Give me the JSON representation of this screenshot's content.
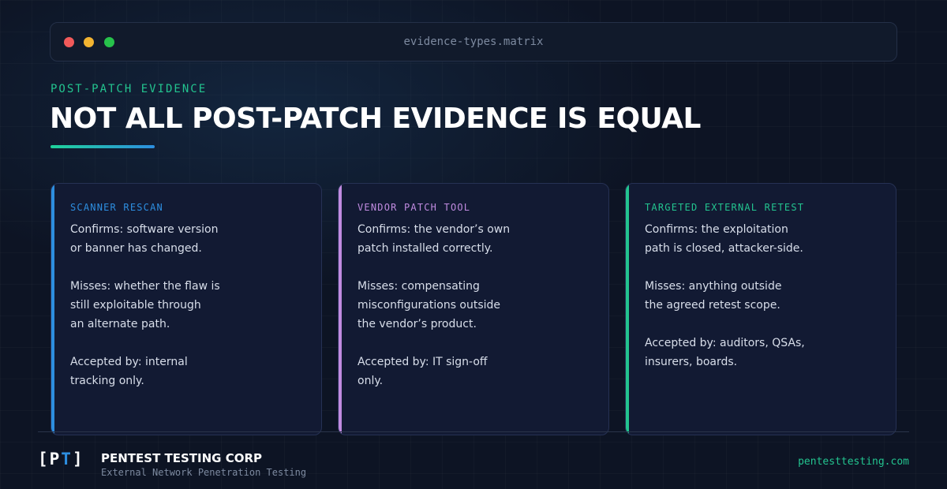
{
  "window": {
    "title": "evidence-types.matrix",
    "controls": [
      "close-dot",
      "minimize-dot",
      "maximize-dot"
    ]
  },
  "hero": {
    "eyebrow": "POST-PATCH EVIDENCE",
    "headline": "NOT ALL POST-PATCH EVIDENCE IS EQUAL"
  },
  "cards": [
    {
      "tag": "SCANNER RESCAN",
      "accent": "#2d8ee0",
      "lines": [
        "Confirms: software version",
        "or banner has changed.",
        "",
        "Misses: whether the flaw is",
        "still exploitable through",
        "an alternate path.",
        "",
        "Accepted by: internal",
        "tracking only."
      ]
    },
    {
      "tag": "VENDOR PATCH TOOL",
      "accent": "#c08be0",
      "lines": [
        "Confirms: the vendor’s own",
        "patch installed correctly.",
        "",
        "Misses: compensating",
        "misconfigurations outside",
        "the vendor’s product.",
        "",
        "Accepted by: IT sign-off",
        "only."
      ]
    },
    {
      "tag": "TARGETED EXTERNAL RETEST",
      "accent": "#23c48f",
      "lines": [
        "Confirms: the exploitation",
        "path is closed, attacker-side.",
        "",
        "Misses: anything outside",
        "the agreed retest scope.",
        "",
        "Accepted by: auditors, QSAs,",
        "insurers, boards."
      ]
    }
  ],
  "footer": {
    "logo_open": "[P",
    "logo_t": "T",
    "logo_close": "]",
    "company": "PENTEST TESTING CORP",
    "tagline": "External Network Penetration Testing",
    "site": "pentesttesting.com"
  }
}
